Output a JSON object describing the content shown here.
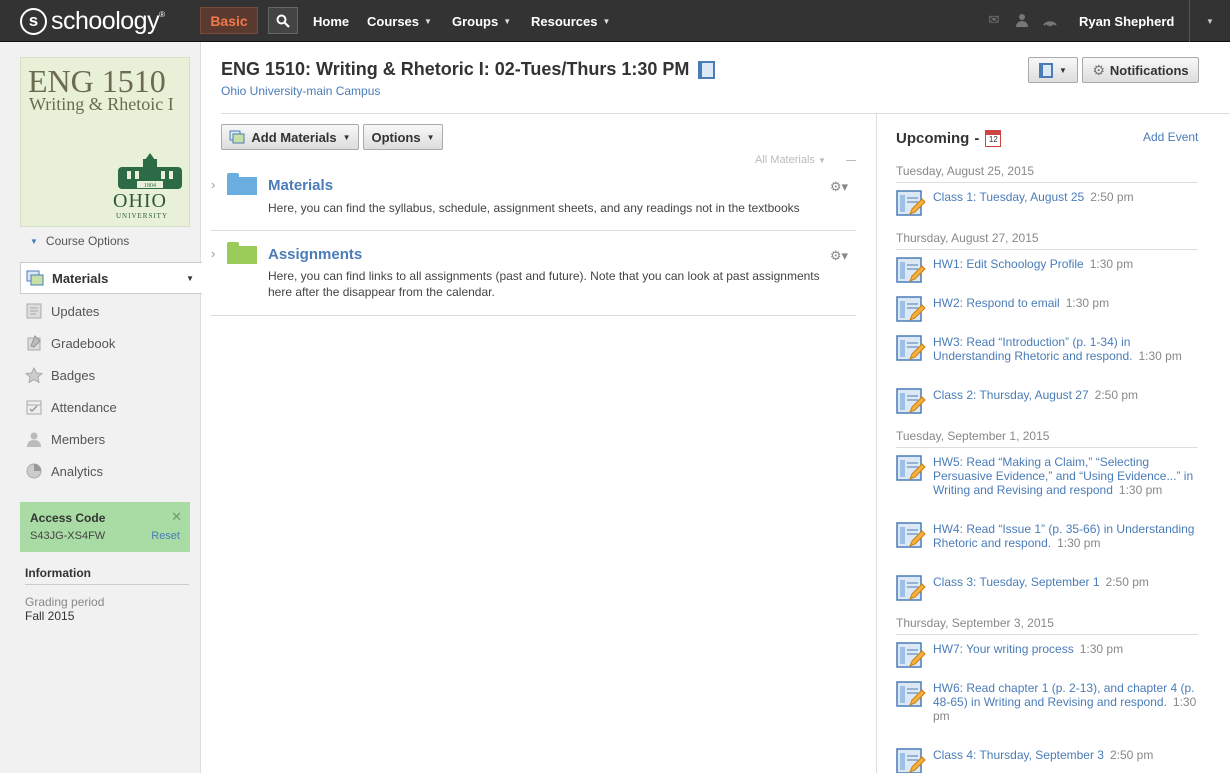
{
  "topbar": {
    "logo": "schoology",
    "basic_label": "Basic",
    "nav": [
      {
        "label": "Home",
        "dropdown": false
      },
      {
        "label": "Courses",
        "dropdown": true
      },
      {
        "label": "Groups",
        "dropdown": true
      },
      {
        "label": "Resources",
        "dropdown": true
      }
    ],
    "user_name": "Ryan Shepherd",
    "icons": [
      "mail-icon",
      "people-icon",
      "notifications-signal-icon"
    ]
  },
  "course_picture": {
    "line1": "ENG 1510",
    "line2": "Writing & Rhetoic I",
    "seal_year": "1804",
    "university": "OHIO",
    "university_sub": "UNIVERSITY"
  },
  "left_nav": {
    "course_options": "Course Options",
    "items": [
      {
        "label": "Materials",
        "icon": "materials-icon",
        "active": true
      },
      {
        "label": "Updates",
        "icon": "updates-icon",
        "active": false
      },
      {
        "label": "Gradebook",
        "icon": "gradebook-icon",
        "active": false
      },
      {
        "label": "Badges",
        "icon": "badge-icon",
        "active": false
      },
      {
        "label": "Attendance",
        "icon": "attendance-icon",
        "active": false
      },
      {
        "label": "Members",
        "icon": "members-icon",
        "active": false
      },
      {
        "label": "Analytics",
        "icon": "analytics-icon",
        "active": false
      }
    ],
    "access_code": {
      "title": "Access Code",
      "code": "S43JG-XS4FW",
      "reset": "Reset"
    },
    "information": {
      "title": "Information",
      "grading_period_label": "Grading period",
      "grading_period_value": "Fall 2015"
    }
  },
  "header": {
    "title": "ENG 1510: Writing & Rhetoric I: 02-Tues/Thurs 1:30 PM",
    "subtitle": "Ohio University-main Campus",
    "notifications_label": "Notifications"
  },
  "toolbar": {
    "add_materials": "Add Materials",
    "options": "Options",
    "filter": "All Materials"
  },
  "folders": [
    {
      "title": "Materials",
      "description": "Here, you can find the syllabus, schedule, assignment sheets, and any readings not in the textbooks",
      "color": "#6aaee0"
    },
    {
      "title": "Assignments",
      "description": "Here, you can find links to all assignments (past and future). Note that you can look at past assignments here after the disappear from the calendar.",
      "color": "#9bcc5a"
    }
  ],
  "upcoming": {
    "title": "Upcoming",
    "calendar_day": "12",
    "add_event": "Add Event",
    "groups": [
      {
        "date": "Tuesday, August 25, 2015",
        "events": [
          {
            "title": "Class 1: Tuesday, August 25",
            "time": "2:50 pm"
          }
        ]
      },
      {
        "date": "Thursday, August 27, 2015",
        "events": [
          {
            "title": "HW1: Edit Schoology Profile",
            "time": "1:30 pm"
          },
          {
            "title": "HW2: Respond to email",
            "time": "1:30 pm"
          },
          {
            "title": "HW3: Read “Introduction” (p. 1-34) in Understanding Rhetoric and respond.",
            "time": "1:30 pm"
          },
          {
            "title": "Class 2: Thursday, August 27",
            "time": "2:50 pm"
          }
        ]
      },
      {
        "date": "Tuesday, September 1, 2015",
        "events": [
          {
            "title": "HW5: Read “Making a Claim,” “Selecting Persuasive Evidence,” and “Using Evidence...” in Writing and Revising and respond",
            "time": "1:30 pm"
          },
          {
            "title": "HW4: Read “Issue 1” (p. 35-66) in Understanding Rhetoric and respond.",
            "time": "1:30 pm"
          },
          {
            "title": "Class 3: Tuesday, September 1",
            "time": "2:50 pm"
          }
        ]
      },
      {
        "date": "Thursday, September 3, 2015",
        "events": [
          {
            "title": "HW7: Your writing process",
            "time": "1:30 pm"
          },
          {
            "title": "HW6: Read chapter 1 (p. 2-13), and chapter 4 (p. 48-65) in Writing and Revising and respond.",
            "time": "1:30 pm"
          },
          {
            "title": "Class 4: Thursday, September 3",
            "time": "2:50 pm"
          }
        ]
      }
    ]
  }
}
